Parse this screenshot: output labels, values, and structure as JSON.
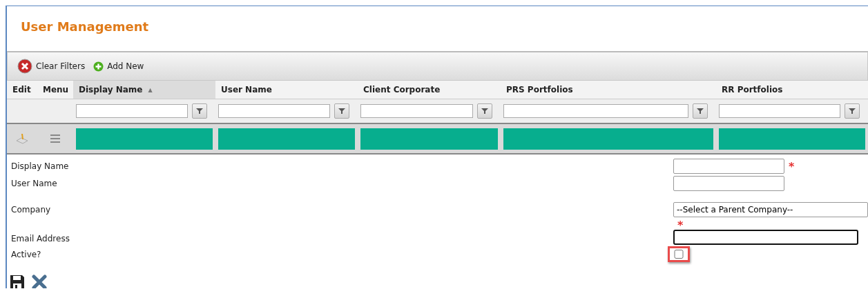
{
  "title": "User Management",
  "toolbar": [
    {
      "kind": "clear",
      "label": "Clear Filters"
    },
    {
      "kind": "add",
      "label": "Add New"
    }
  ],
  "grid": {
    "columns": [
      {
        "label": "Edit",
        "filter": false,
        "sorted": false
      },
      {
        "label": "Menu",
        "filter": false,
        "sorted": false
      },
      {
        "label": "Display Name",
        "filter": true,
        "sorted": true,
        "sort_icon": "▲"
      },
      {
        "label": "User Name",
        "filter": true,
        "sorted": false
      },
      {
        "label": "Client Corporate",
        "filter": true,
        "sorted": false
      },
      {
        "label": "PRS Portfolios",
        "filter": true,
        "sorted": false
      },
      {
        "label": "RR Portfolios",
        "filter": true,
        "sorted": false
      }
    ],
    "row": [
      {
        "kind": "edit"
      },
      {
        "kind": "menu"
      },
      {
        "kind": "redacted"
      },
      {
        "kind": "redacted"
      },
      {
        "kind": "redacted"
      },
      {
        "kind": "redacted"
      },
      {
        "kind": "redacted"
      }
    ]
  },
  "form": [
    {
      "label": "Display Name",
      "kind": "text",
      "required": true,
      "focused": false
    },
    {
      "label": "User Name",
      "kind": "text",
      "required": false,
      "focused": false
    },
    {
      "label": "Company",
      "kind": "select",
      "value": "--Select a Parent Company--",
      "required": false
    },
    {
      "label": "Email Address",
      "kind": "email",
      "required": true,
      "focused": true
    },
    {
      "label": "Active?",
      "kind": "checkbox",
      "checked": false,
      "highlighted": true
    }
  ],
  "required_mark": "*",
  "actions": [
    {
      "kind": "save"
    },
    {
      "kind": "cancel"
    }
  ]
}
